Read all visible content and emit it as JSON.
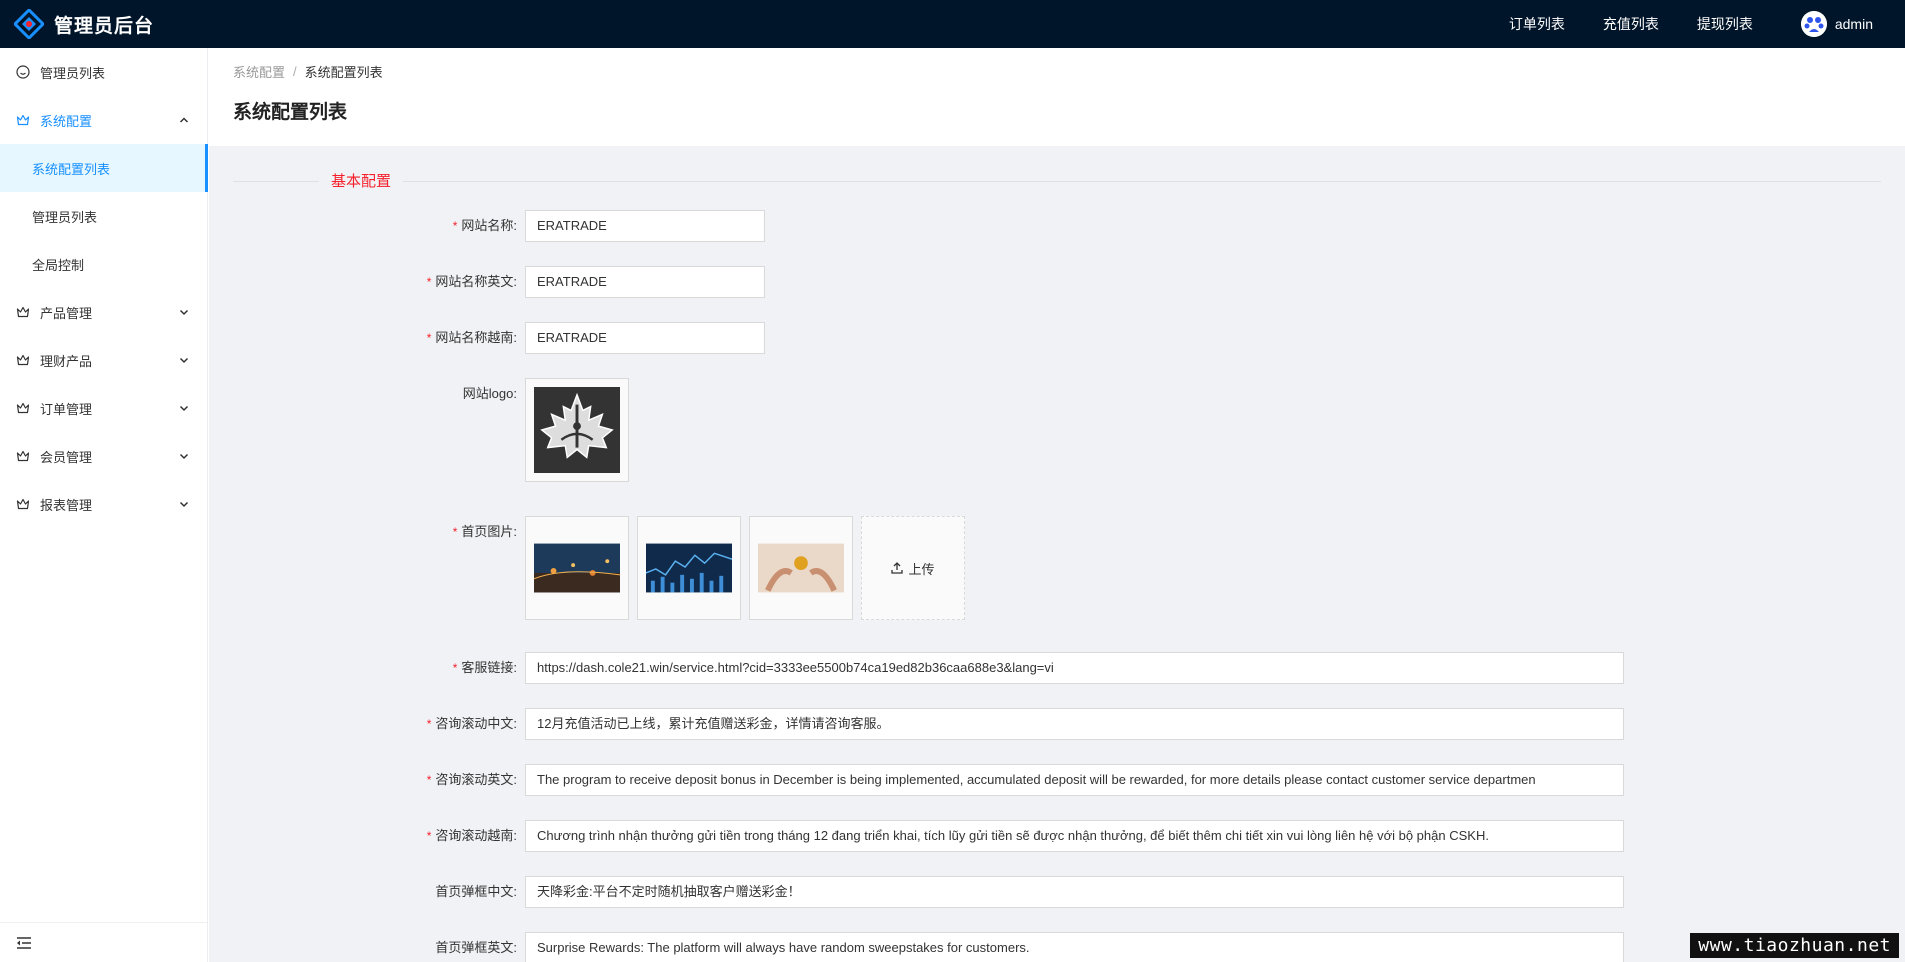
{
  "header": {
    "title": "管理员后台",
    "nav": [
      "订单列表",
      "充值列表",
      "提现列表"
    ],
    "user": "admin"
  },
  "sidebar": {
    "items": [
      {
        "label": "管理员列表",
        "icon": "smile-icon"
      },
      {
        "label": "系统配置",
        "icon": "crown-icon",
        "open": true,
        "children": [
          "系统配置列表",
          "管理员列表",
          "全局控制"
        ],
        "active_child": "系统配置列表"
      },
      {
        "label": "产品管理",
        "icon": "crown-icon"
      },
      {
        "label": "理财产品",
        "icon": "crown-icon"
      },
      {
        "label": "订单管理",
        "icon": "crown-icon"
      },
      {
        "label": "会员管理",
        "icon": "crown-icon"
      },
      {
        "label": "报表管理",
        "icon": "crown-icon"
      }
    ]
  },
  "breadcrumb": [
    "系统配置",
    "系统配置列表"
  ],
  "page_title": "系统配置列表",
  "section_title": "基本配置",
  "form": {
    "site_name": {
      "label": "网站名称:",
      "value": "ERATRADE"
    },
    "site_name_en": {
      "label": "网站名称英文:",
      "value": "ERATRADE"
    },
    "site_name_vi": {
      "label": "网站名称越南:",
      "value": "ERATRADE"
    },
    "site_logo": {
      "label": "网站logo:"
    },
    "home_images": {
      "label": "首页图片:",
      "upload_label": "上传"
    },
    "service_link": {
      "label": "客服链接:",
      "value": "https://dash.cole21.win/service.html?cid=3333ee5500b74ca19ed82b36caa688e3&lang=vi"
    },
    "marquee_zh": {
      "label": "咨询滚动中文:",
      "value": "12月充值活动已上线，累计充值赠送彩金，详情请咨询客服。"
    },
    "marquee_en": {
      "label": "咨询滚动英文:",
      "value": "The program to receive deposit bonus in December is being implemented, accumulated deposit will be rewarded, for more details please contact customer service departmen"
    },
    "marquee_vi": {
      "label": "咨询滚动越南:",
      "value": "Chương trình nhận thưởng gửi tiền trong tháng 12 đang triển khai, tích lũy gửi tiền sẽ được nhận thưởng, để biết thêm chi tiết xin vui lòng liên hệ với bộ phận CSKH."
    },
    "popup_zh": {
      "label": "首页弹框中文:",
      "value": "天降彩金:平台不定时随机抽取客户赠送彩金！"
    },
    "popup_en": {
      "label": "首页弹框英文:",
      "value": "Surprise Rewards: The platform will always have random sweepstakes for customers."
    }
  },
  "watermark": "www.tiaozhuan.net",
  "colors": {
    "topbar": "#001529",
    "accent": "#1890ff",
    "required": "#f5222d"
  }
}
